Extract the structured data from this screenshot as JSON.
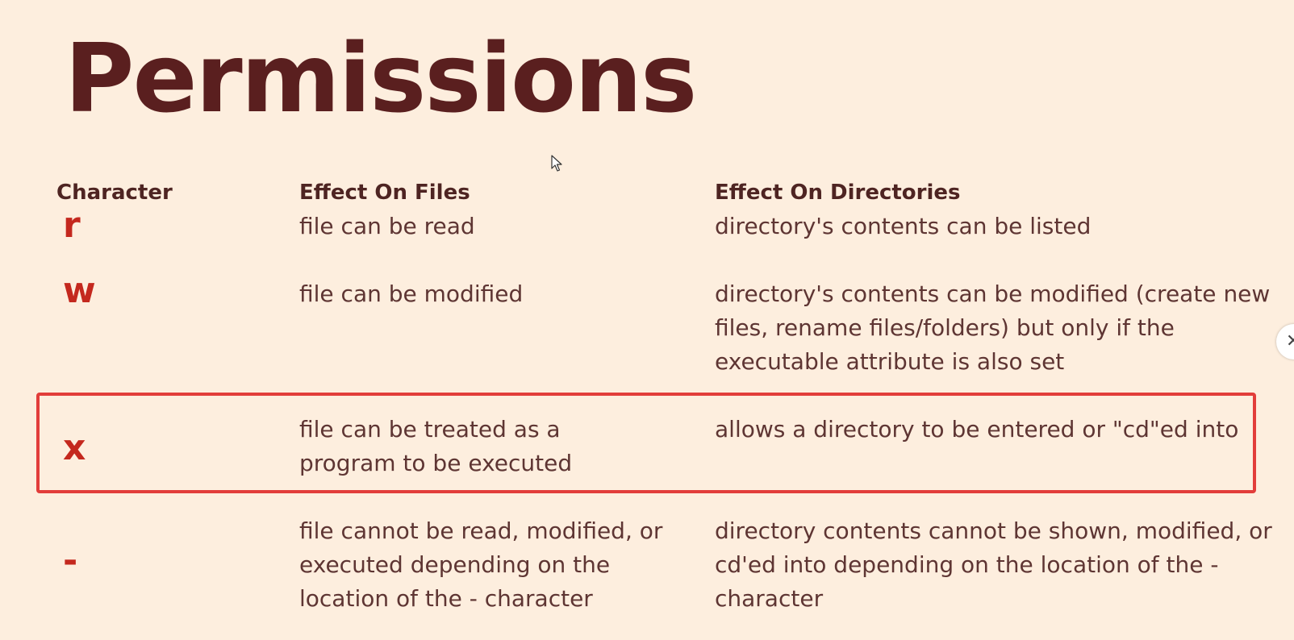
{
  "slide": {
    "title": "Permissions",
    "headers": {
      "character": "Character",
      "files": "Effect On Files",
      "directories": "Effect On Directories"
    },
    "rows": [
      {
        "char": "r",
        "files": "file can be read",
        "dirs": "directory's contents can be listed"
      },
      {
        "char": "w",
        "files": "file can be modified",
        "dirs": "directory's contents can be modified (create new files, rename files/folders) but only if the executable attribute is also set"
      },
      {
        "char": "x",
        "files": "file can be treated as a program to be executed",
        "dirs": "allows a directory to be entered or \"cd\"ed into",
        "highlighted": true
      },
      {
        "char": "-",
        "files": "file cannot be read, modified, or executed depending on the location of the - character",
        "dirs": "directory contents cannot be shown, modified, or cd'ed into depending on the location of the - character"
      }
    ]
  },
  "overlay": {
    "edge_button_icon": "close-icon",
    "cursor_icon": "mouse-pointer-icon"
  },
  "colors": {
    "background": "#fdeede",
    "title": "#5a1f1f",
    "character_accent": "#c4281e",
    "highlight_border": "#e23d3a"
  }
}
